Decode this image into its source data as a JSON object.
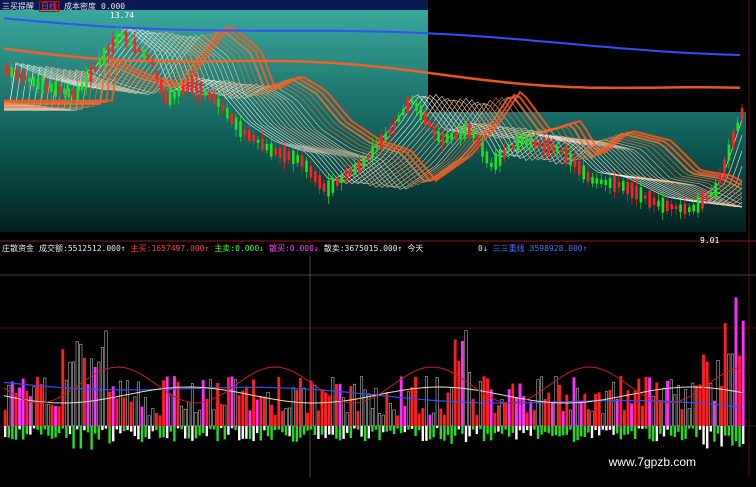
{
  "top_header": {
    "name_a": "三买提醒",
    "boxed": "日线",
    "name_b": "成本密度",
    "value_a": "0.000"
  },
  "sub_header": {
    "indicator": "庄散资金",
    "vol_label": "成交额:",
    "vol_value": "5512512.000↑",
    "zhumai_label": "主买:",
    "zhumai_value": "1657497.000↑",
    "zhumai2_label": "主卖:",
    "zhumai2_value": "0.000↓",
    "sanmai_label": "散买:",
    "sanmai_value": "0.000↓",
    "sanmai2_label": "散卖:",
    "sanmai2_value": "3675015.000↑",
    "tail": "今天"
  },
  "right_header": {
    "a": "0↓",
    "b": "三三重线",
    "c": "3598928.000↑"
  },
  "price_labels": {
    "high": "13.74",
    "low": "9.01"
  },
  "watermark": "www.7gpzb.com",
  "colors": {
    "up": "#ff2020",
    "down": "#20e020",
    "teal_bg": "#1a6b66",
    "magenta": "#ff30ff",
    "blue_line": "#3050ff",
    "orange_line": "#ff6020"
  }
}
